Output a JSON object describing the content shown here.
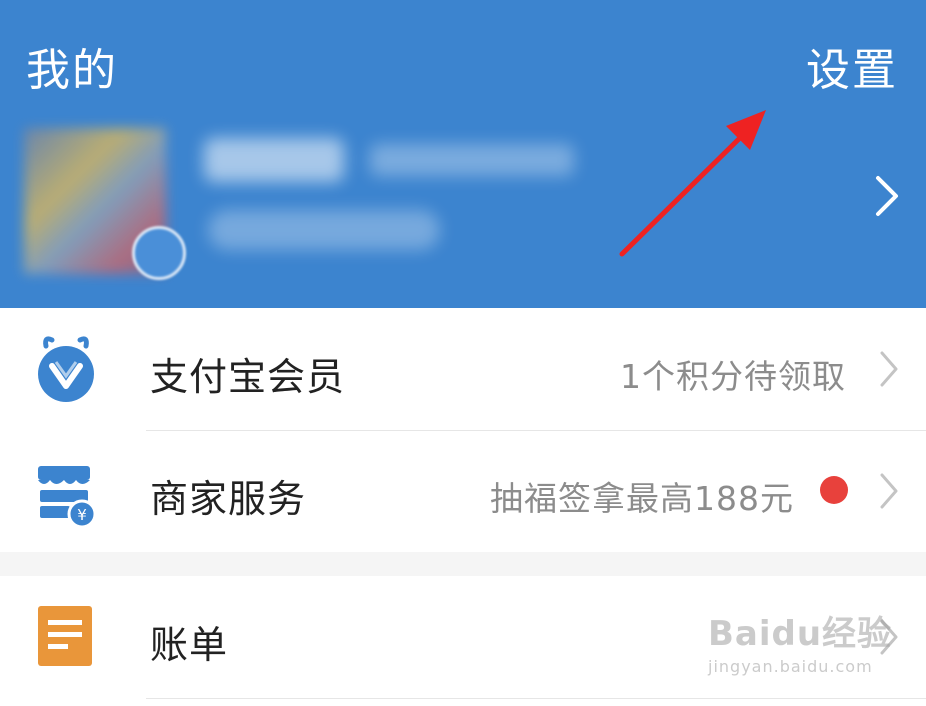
{
  "header": {
    "title": "我的",
    "settings_label": "设置",
    "background_color": "#3c84cf"
  },
  "profile": {
    "avatar_icon": "avatar",
    "chevron_icon": "chevron-right-icon",
    "note": ""
  },
  "annotation": {
    "arrow_color": "#ee2222"
  },
  "menu": {
    "items": [
      {
        "icon": "alipay-member-icon",
        "label": "支付宝会员",
        "value": "1个积分待领取",
        "has_dot": false
      },
      {
        "icon": "merchant-service-icon",
        "label": "商家服务",
        "value": "抽福签拿最高188元",
        "has_dot": true
      },
      {
        "icon": "bill-icon",
        "label": "账单",
        "value": "",
        "has_dot": false
      }
    ],
    "dot_color": "#e8413c"
  },
  "watermark": {
    "main": "Baidu经验",
    "sub": "jingyan.baidu.com"
  }
}
